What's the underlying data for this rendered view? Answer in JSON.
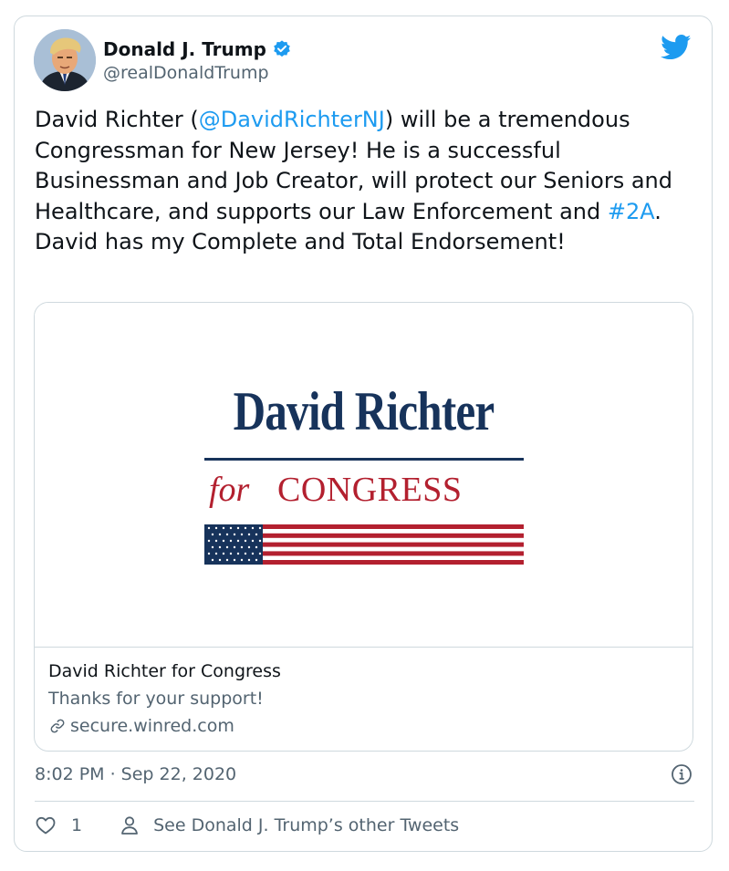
{
  "tweet": {
    "author_name": "Donald J. Trump",
    "author_handle": "@realDonaldTrump",
    "text_parts": [
      "David Richter (",
      "@DavidRichterNJ",
      ") will be a tremendous Congressman for New Jersey! He is a successful Businessman and Job Creator, will protect our Seniors and Healthcare, and supports our Law Enforcement and ",
      "#2A",
      ". David has my Complete and Total Endorsement!"
    ],
    "timestamp": "8:02 PM · Sep 22, 2020"
  },
  "link_card": {
    "logo_name": "David Richter",
    "logo_for": "for",
    "logo_congress": "CONGRESS",
    "title": "David Richter for Congress",
    "description": "Thanks for your support!",
    "domain": "secure.winred.com"
  },
  "actions": {
    "like_count": "1",
    "other_tweets": "See Donald J. Trump’s other Tweets"
  },
  "colors": {
    "link_blue": "#1d9bf0",
    "muted_text": "#536471",
    "logo_navy": "#17335b",
    "logo_red": "#b3202f"
  },
  "icons": {
    "brand": "twitter-bird-icon",
    "verified": "verified-badge-icon",
    "link": "link-icon",
    "info": "info-icon",
    "like": "heart-icon",
    "profile": "person-icon"
  }
}
